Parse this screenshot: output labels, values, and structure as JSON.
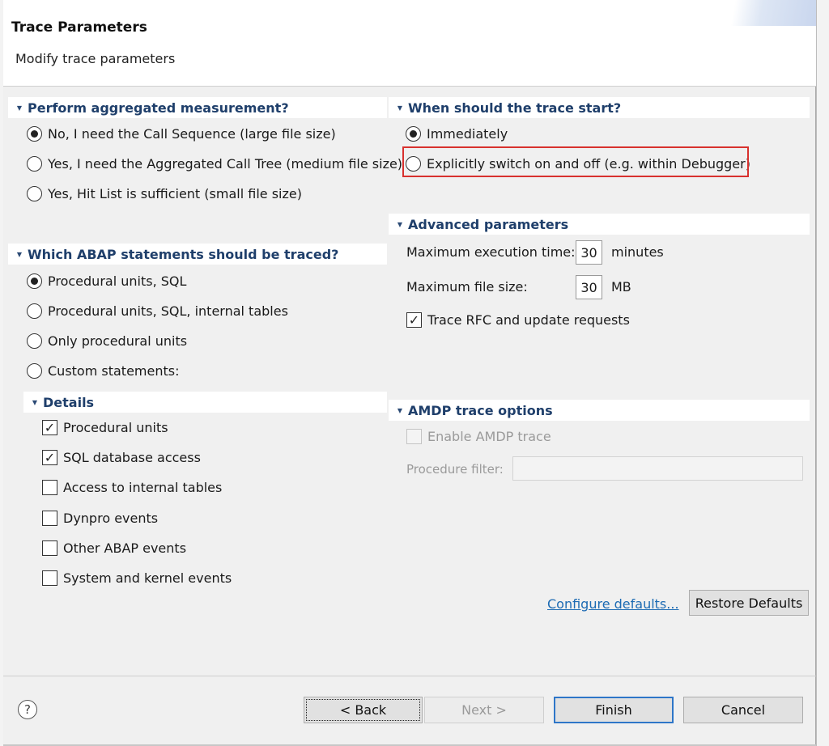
{
  "header": {
    "title": "Trace Parameters",
    "subtitle": "Modify trace parameters"
  },
  "aggregated": {
    "heading": "Perform aggregated measurement?",
    "options": [
      {
        "label": "No, I need the Call Sequence (large file size)",
        "selected": true
      },
      {
        "label": "Yes, I need the Aggregated Call Tree (medium file size)",
        "selected": false
      },
      {
        "label": "Yes, Hit List is sufficient (small file size)",
        "selected": false
      }
    ]
  },
  "trace_start": {
    "heading": "When should the trace start?",
    "options": [
      {
        "label": "Immediately",
        "selected": true
      },
      {
        "label": "Explicitly switch on and off (e.g. within Debugger)",
        "selected": false
      }
    ]
  },
  "advanced": {
    "heading": "Advanced parameters",
    "max_exec_label": "Maximum execution time:",
    "max_exec_value": "30",
    "max_exec_unit": "minutes",
    "max_file_label": "Maximum file size:",
    "max_file_value": "30",
    "max_file_unit": "MB",
    "rfc_label": "Trace RFC and update requests",
    "rfc_checked": true
  },
  "statements": {
    "heading": "Which ABAP statements should be traced?",
    "options": [
      {
        "label": "Procedural units, SQL",
        "selected": true
      },
      {
        "label": "Procedural units, SQL, internal tables",
        "selected": false
      },
      {
        "label": "Only procedural units",
        "selected": false
      },
      {
        "label": "Custom statements:",
        "selected": false
      }
    ]
  },
  "details": {
    "heading": "Details",
    "items": [
      {
        "label": "Procedural units",
        "checked": true
      },
      {
        "label": "SQL database access",
        "checked": true
      },
      {
        "label": "Access to internal tables",
        "checked": false
      },
      {
        "label": "Dynpro events",
        "checked": false
      },
      {
        "label": "Other ABAP events",
        "checked": false
      },
      {
        "label": "System and kernel events",
        "checked": false
      }
    ]
  },
  "amdp": {
    "heading": "AMDP trace options",
    "enable_label": "Enable AMDP trace",
    "filter_label": "Procedure filter:",
    "filter_value": ""
  },
  "links": {
    "configure_defaults": "Configure defaults...",
    "restore_defaults": "Restore Defaults"
  },
  "buttons": {
    "help": "?",
    "back": "< Back",
    "next": "Next >",
    "finish": "Finish",
    "cancel": "Cancel"
  },
  "colors": {
    "accent": "#2e76c8",
    "highlight": "#d8312e",
    "section_heading": "#1f3f6b",
    "link": "#1d6bb3"
  }
}
